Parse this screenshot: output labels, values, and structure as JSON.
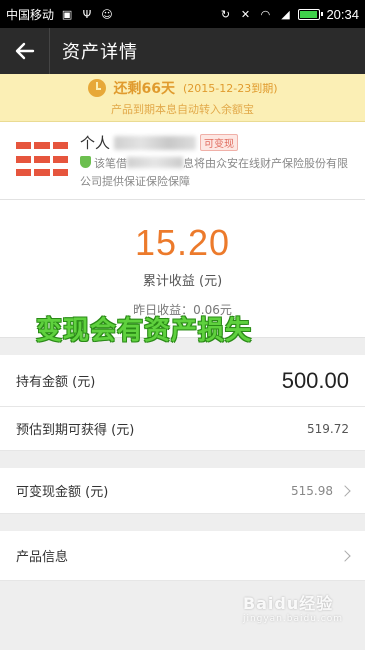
{
  "status_bar": {
    "carrier": "中国移动",
    "time": "20:34",
    "icons": [
      "image-icon",
      "usb-icon",
      "android-icon",
      "sync-icon",
      "mute-icon",
      "wifi-icon",
      "signal-icon",
      "battery-icon"
    ]
  },
  "header": {
    "title": "资产详情",
    "back_icon": "arrow-left-icon"
  },
  "notice": {
    "days_left": "还剩66天",
    "due_date": "(2015-12-23到期)",
    "auto_transfer": "产品到期本息自动转入余额宝"
  },
  "product": {
    "name": "个人",
    "tag": "可变现",
    "desc_prefix": "该笔借",
    "desc_suffix": "息将由众安在线财产保险股份有限公司提供保证保险保障"
  },
  "earnings": {
    "amount": "15.20",
    "label": "累计收益 (元)",
    "yesterday": "昨日收益：0.06元"
  },
  "overlay": {
    "text": "变现会有资产损失"
  },
  "holdings": {
    "amount_label": "持有金额 (元)",
    "amount_value": "500.00",
    "expected_label": "预估到期可获得 (元)",
    "expected_value": "519.72"
  },
  "cashable": {
    "label": "可变现金额 (元)",
    "value": "515.98"
  },
  "product_info": {
    "label": "产品信息"
  },
  "watermark": {
    "text": "Baidu经验",
    "sub": "jingyan.baidu.com"
  },
  "colors": {
    "accent": "#ec7a2b",
    "notice_bg": "#fbefb5",
    "header_bg": "#2b2b2b",
    "overlay_green": "#5fd13e"
  }
}
